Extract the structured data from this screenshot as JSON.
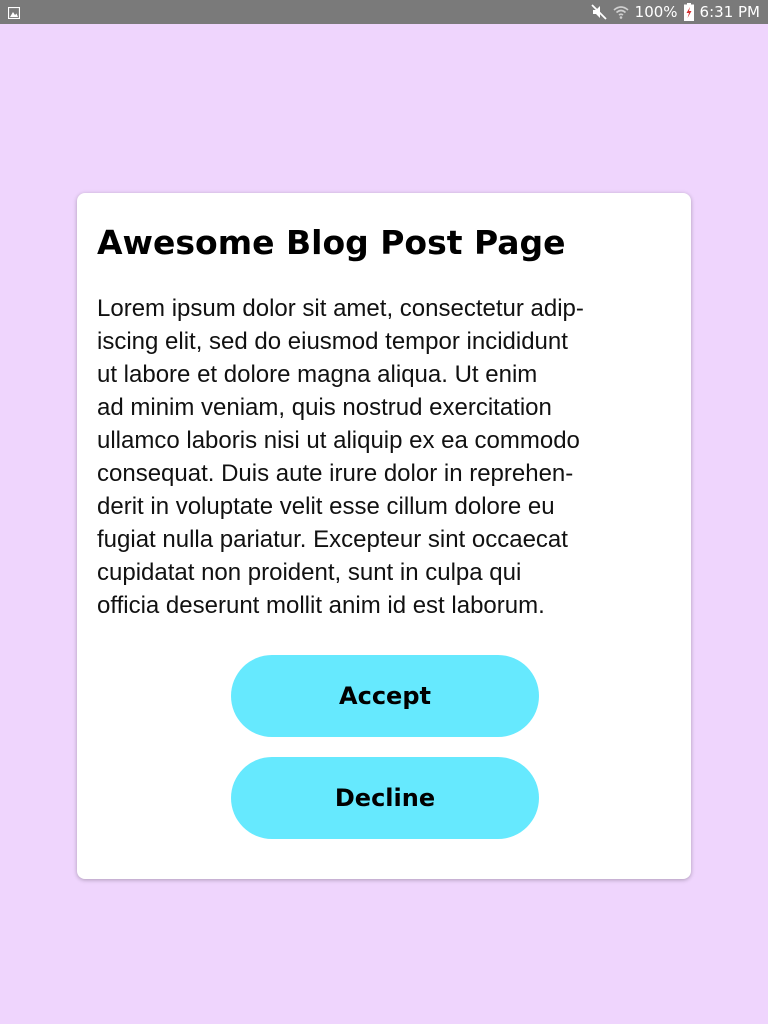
{
  "status_bar": {
    "left_icon": "image-notification-icon",
    "mute_icon": "mute-icon",
    "wifi_icon": "wifi-icon",
    "battery_percent": "100%",
    "battery_icon": "battery-charging-icon",
    "time": "6:31 PM"
  },
  "dialog": {
    "title": "Awesome Blog Post Page",
    "body_lines": [
      "Lorem ipsum dolor sit amet, consectetur adip-",
      "iscing elit, sed do eiusmod tempor incididunt",
      "ut labore et dolore magna aliqua. Ut enim",
      "ad minim veniam, quis nostrud exercitation",
      "ullamco laboris nisi ut aliquip ex ea commodo",
      "consequat. Duis aute irure dolor in reprehen-",
      "derit in voluptate velit esse cillum dolore eu",
      "fugiat nulla pariatur. Excepteur sint occaecat",
      "cupidatat non proident, sunt in culpa qui",
      "officia deserunt mollit anim id est laborum."
    ],
    "accept_label": "Accept",
    "decline_label": "Decline"
  },
  "colors": {
    "background": "#efd5fd",
    "button": "#66e9fe",
    "status_bar": "#7a7a7a"
  }
}
